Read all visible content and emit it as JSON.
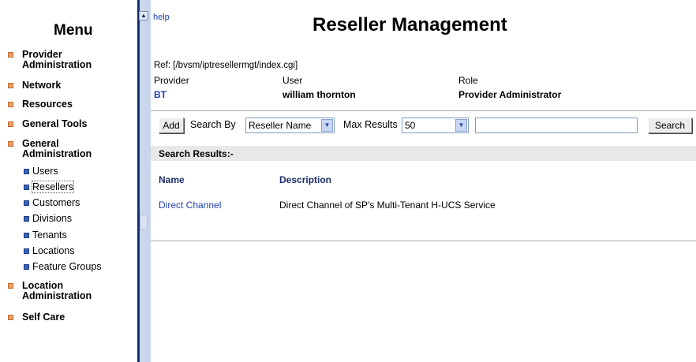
{
  "menu": {
    "title": "Menu",
    "items": [
      {
        "label": "Provider Administration"
      },
      {
        "label": "Network"
      },
      {
        "label": "Resources"
      },
      {
        "label": "General Tools"
      },
      {
        "label": "General Administration"
      },
      {
        "label": "Location Administration"
      },
      {
        "label": "Self Care"
      }
    ],
    "subitems": [
      {
        "label": "Users"
      },
      {
        "label": "Resellers"
      },
      {
        "label": "Customers"
      },
      {
        "label": "Divisions"
      },
      {
        "label": "Tenants"
      },
      {
        "label": "Locations"
      },
      {
        "label": "Feature Groups"
      }
    ]
  },
  "help": "help",
  "page_title": "Reseller Management",
  "ref": "Ref: [/bvsm/iptresellermgt/index.cgi]",
  "header": {
    "provider_label": "Provider",
    "provider_value": "BT",
    "user_label": "User",
    "user_value": "william thornton",
    "role_label": "Role",
    "role_value": "Provider Administrator"
  },
  "toolbar": {
    "add_label": "Add",
    "search_by_label": "Search By",
    "search_by_value": "Reseller Name",
    "max_results_label": "Max Results",
    "max_results_value": "50",
    "search_input_value": "",
    "search_button_label": "Search"
  },
  "results": {
    "label": "Search Results:-",
    "columns": [
      "Name",
      "Description"
    ],
    "rows": [
      {
        "name": "Direct Channel",
        "description": "Direct Channel of SP's Multi-Tenant H-UCS Service"
      }
    ]
  },
  "colors": {
    "link": "#2040b0",
    "menu_bullet": "#e9a06c",
    "sub_bullet": "#3a62b8",
    "divider": "#14306b"
  }
}
